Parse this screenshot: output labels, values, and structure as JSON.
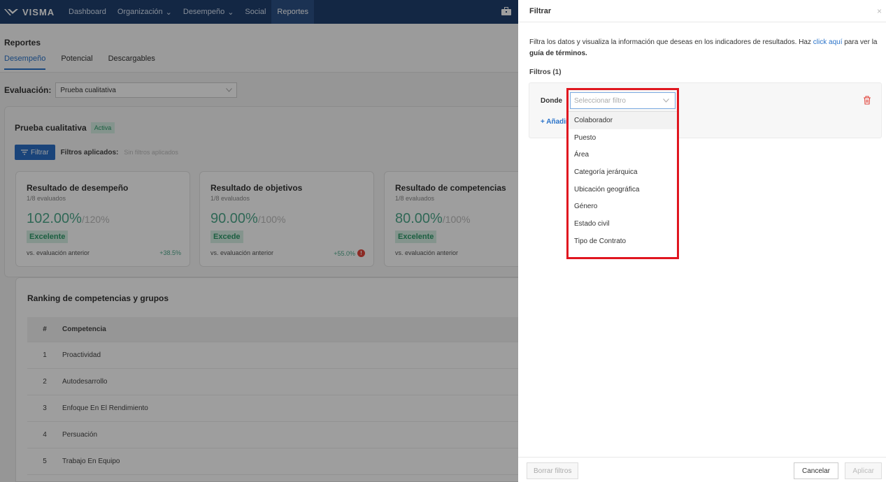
{
  "nav": {
    "logo": "VISMA",
    "items": [
      {
        "label": "Dashboard",
        "has_chevron": false
      },
      {
        "label": "Organización",
        "has_chevron": true
      },
      {
        "label": "Desempeño",
        "has_chevron": true
      },
      {
        "label": "Social",
        "has_chevron": false
      },
      {
        "label": "Reportes",
        "has_chevron": false
      }
    ],
    "chevron": "⌄",
    "right_icon": "briefcase-icon"
  },
  "page": {
    "title": "Reportes",
    "tabs": [
      "Desempeño",
      "Potencial",
      "Descargables"
    ],
    "active_tab": "Desempeño"
  },
  "evaluation": {
    "label": "Evaluación:",
    "value": "Prueba cualitativa"
  },
  "report": {
    "title": "Prueba cualitativa",
    "status": "Activa",
    "filter_button": "Filtrar",
    "applied_label": "Filtros aplicados:",
    "applied_value": "Sin filtros aplicados"
  },
  "metrics": [
    {
      "title": "Resultado de desempeño",
      "evaluated": "1/8 evaluados",
      "value": "102.00%",
      "max": "/120%",
      "badge": "Excelente",
      "vs": "vs. evaluación anterior",
      "delta": "+38.5%",
      "alert": ""
    },
    {
      "title": "Resultado de objetivos",
      "evaluated": "1/8 evaluados",
      "value": "90.00%",
      "max": "/100%",
      "badge": "Excede",
      "vs": "vs. evaluación anterior",
      "delta": "+55.0%",
      "alert": "!"
    },
    {
      "title": "Resultado de competencias",
      "evaluated": "1/8 evaluados",
      "value": "80.00%",
      "max": "/100%",
      "badge": "Excelente",
      "vs": "vs. evaluación anterior",
      "delta": "",
      "alert": ""
    }
  ],
  "ranking": {
    "title": "Ranking de competencias y grupos",
    "columns": [
      "#",
      "Competencia"
    ],
    "rows": [
      {
        "num": "1",
        "name": "Proactividad"
      },
      {
        "num": "2",
        "name": "Autodesarrollo"
      },
      {
        "num": "3",
        "name": "Enfoque En El Rendimiento"
      },
      {
        "num": "4",
        "name": "Persuación"
      },
      {
        "num": "5",
        "name": "Trabajo En Equipo"
      }
    ]
  },
  "drawer": {
    "title": "Filtrar",
    "close": "×",
    "desc_before": "Filtra los datos y visualiza la información que deseas en los indicadores de resultados. Haz ",
    "desc_link": "click aquí",
    "desc_middle": " para ver la ",
    "desc_bold": "guía de términos.",
    "filters_count": "Filtros (1)",
    "donde_label": "Donde",
    "add_filter": "+ Añadir",
    "select_placeholder": "Seleccionar filtro",
    "options": [
      "Colaborador",
      "Puesto",
      "Área",
      "Categoría jerárquica",
      "Ubicación geográfica",
      "Género",
      "Estado civil",
      "Tipo de Contrato"
    ],
    "hovered_option": "Colaborador",
    "clear_button": "Borrar filtros",
    "cancel_button": "Cancelar",
    "apply_button": "Aplicar"
  },
  "colors": {
    "nav_bg": "#1f3f6e",
    "accent": "#2a6fc6",
    "success": "#4ea88c",
    "highlight": "#e0161f",
    "danger": "#e2463d"
  }
}
